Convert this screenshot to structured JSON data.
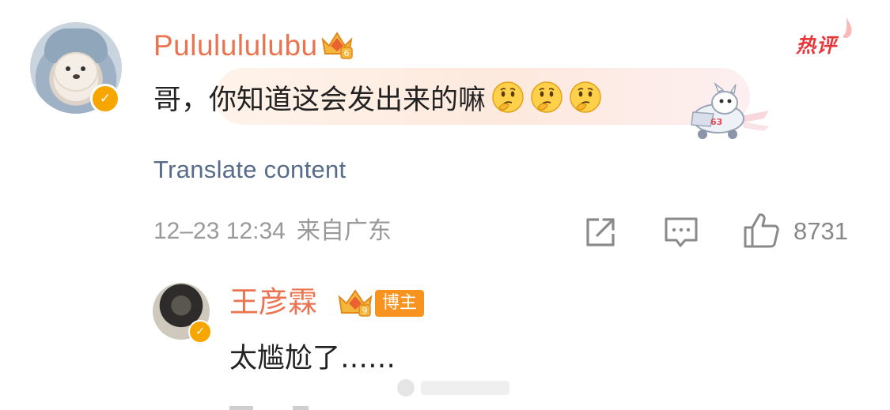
{
  "comment": {
    "username": "Pululululubu",
    "crown_level": "6",
    "hot_badge": "热评",
    "text": "哥，你知道这会发出来的嘛",
    "emojis": [
      "thinking-emoji",
      "thinking-emoji",
      "thinking-emoji"
    ],
    "translate_label": "Translate content",
    "timestamp": "12–23 12:34",
    "location": "来自广东",
    "like_count": "8731"
  },
  "reply": {
    "username": "王彦霖",
    "crown_level": "9",
    "host_badge": "博主",
    "text": "太尴尬了……"
  },
  "colors": {
    "username": "#eb7350",
    "link": "#566c8a",
    "meta": "#999999",
    "verified": "#f7a600",
    "hot": "#e8373a",
    "host_badge": "#f7931e"
  }
}
